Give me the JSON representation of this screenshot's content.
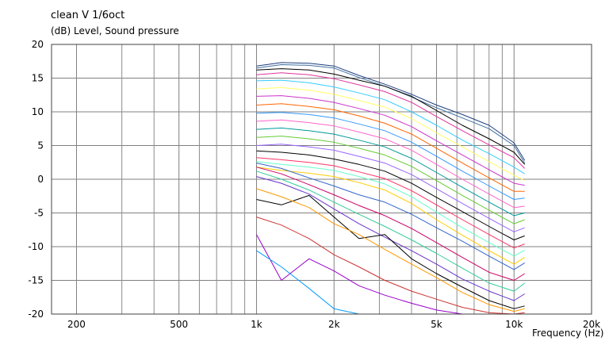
{
  "chart_data": {
    "type": "line",
    "title": "clean V 1/6oct",
    "ylabel": "(dB)  Level, Sound pressure",
    "xlabel": "Frequency  (Hz)",
    "x_scale": "log",
    "xlim": [
      160,
      20000
    ],
    "ylim": [
      -20,
      20
    ],
    "grid": true,
    "x_ticks": [
      {
        "value": 200,
        "label": "200"
      },
      {
        "value": 500,
        "label": "500"
      },
      {
        "value": 1000,
        "label": "1k"
      },
      {
        "value": 2000,
        "label": "2k"
      },
      {
        "value": 5000,
        "label": "5k"
      },
      {
        "value": 10000,
        "label": "10k"
      },
      {
        "value": 20000,
        "label": "20k"
      }
    ],
    "x_minor_ticks": [
      300,
      400,
      600,
      700,
      800,
      900,
      3000,
      4000,
      6000,
      7000,
      8000,
      9000
    ],
    "y_ticks": [
      -20,
      -15,
      -10,
      -5,
      0,
      5,
      10,
      15,
      20
    ],
    "x": [
      1000,
      1250,
      1600,
      2000,
      2500,
      3150,
      4000,
      5000,
      6300,
      8000,
      10000,
      11000
    ],
    "series": [
      {
        "color": "#1f3f7f",
        "values": [
          16.8,
          17.3,
          17.2,
          16.8,
          15.4,
          14.1,
          12.6,
          11.0,
          9.6,
          8.0,
          5.4,
          2.8
        ]
      },
      {
        "color": "#3f6f9f",
        "values": [
          16.5,
          17.0,
          16.9,
          16.5,
          15.1,
          13.8,
          12.2,
          10.6,
          9.1,
          7.5,
          5.0,
          2.4
        ]
      },
      {
        "color": "#000000",
        "values": [
          16.2,
          16.4,
          16.2,
          15.6,
          14.7,
          13.8,
          12.3,
          10.2,
          8.0,
          6.0,
          4.0,
          2.2
        ]
      },
      {
        "color": "#e0339f",
        "values": [
          15.5,
          15.8,
          15.5,
          14.9,
          14.0,
          13.0,
          11.4,
          9.3,
          7.2,
          5.1,
          3.2,
          1.6
        ]
      },
      {
        "color": "#33ccff",
        "values": [
          14.6,
          14.7,
          14.3,
          13.7,
          12.8,
          11.8,
          10.0,
          8.0,
          5.8,
          3.8,
          1.8,
          0.8
        ]
      },
      {
        "color": "#ffff66",
        "values": [
          13.4,
          13.6,
          13.2,
          12.6,
          11.7,
          10.7,
          9.0,
          6.9,
          4.8,
          2.6,
          0.6,
          -0.2
        ]
      },
      {
        "color": "#cc33cc",
        "values": [
          12.3,
          12.4,
          12.0,
          11.4,
          10.5,
          9.5,
          7.8,
          5.7,
          3.6,
          1.4,
          -0.6,
          -0.9
        ]
      },
      {
        "color": "#ff6600",
        "values": [
          11.0,
          11.2,
          10.8,
          10.3,
          9.4,
          8.3,
          6.7,
          4.6,
          2.4,
          0.2,
          -1.8,
          -1.8
        ]
      },
      {
        "color": "#3399ff",
        "values": [
          9.8,
          9.9,
          9.6,
          9.1,
          8.2,
          7.2,
          5.5,
          3.4,
          1.2,
          -1.0,
          -3.0,
          -2.8
        ]
      },
      {
        "color": "#ff66cc",
        "values": [
          8.6,
          8.8,
          8.4,
          7.9,
          7.0,
          6.0,
          4.3,
          2.2,
          0.0,
          -2.2,
          -4.2,
          -4.0
        ]
      },
      {
        "color": "#009999",
        "values": [
          7.4,
          7.6,
          7.2,
          6.7,
          5.8,
          4.8,
          3.1,
          1.0,
          -1.2,
          -3.4,
          -5.4,
          -5.0
        ]
      },
      {
        "color": "#66cc33",
        "values": [
          6.2,
          6.4,
          6.0,
          5.5,
          4.6,
          3.6,
          1.9,
          -0.2,
          -2.4,
          -4.6,
          -6.6,
          -6.0
        ]
      },
      {
        "color": "#9966ff",
        "values": [
          5.0,
          5.2,
          4.8,
          4.3,
          3.4,
          2.4,
          0.7,
          -1.4,
          -3.6,
          -5.8,
          -7.8,
          -7.2
        ]
      },
      {
        "color": "#000000",
        "values": [
          4.2,
          4.0,
          3.6,
          3.0,
          2.2,
          1.2,
          -0.6,
          -2.7,
          -4.8,
          -7.0,
          -9.0,
          -8.4
        ]
      },
      {
        "color": "#ff3366",
        "values": [
          3.2,
          2.9,
          2.5,
          2.0,
          1.1,
          0.1,
          -1.7,
          -3.8,
          -6.0,
          -8.2,
          -10.2,
          -9.6
        ]
      },
      {
        "color": "#66ffcc",
        "values": [
          2.6,
          2.2,
          1.8,
          1.3,
          0.4,
          -0.7,
          -2.6,
          -4.9,
          -7.2,
          -9.4,
          -11.4,
          -10.5
        ]
      },
      {
        "color": "#ffcc00",
        "values": [
          1.8,
          1.3,
          0.9,
          0.4,
          -0.5,
          -1.6,
          -3.6,
          -6.0,
          -8.3,
          -10.6,
          -12.6,
          -11.6
        ]
      },
      {
        "color": "#3366cc",
        "values": [
          2.4,
          1.6,
          0.2,
          -1.0,
          -2.3,
          -3.4,
          -5.2,
          -7.2,
          -9.2,
          -11.4,
          -13.4,
          -12.4
        ]
      },
      {
        "color": "#cc0066",
        "values": [
          1.8,
          0.8,
          -0.8,
          -2.3,
          -3.9,
          -5.4,
          -7.3,
          -9.4,
          -11.6,
          -13.8,
          -15.0,
          -14.0
        ]
      },
      {
        "color": "#33cc99",
        "values": [
          1.2,
          0.0,
          -1.6,
          -3.4,
          -5.2,
          -7.0,
          -9.0,
          -11.0,
          -13.2,
          -15.4,
          -16.6,
          -15.4
        ]
      },
      {
        "color": "#6633cc",
        "values": [
          0.4,
          -0.6,
          -2.2,
          -4.4,
          -6.6,
          -8.6,
          -10.6,
          -12.6,
          -14.8,
          -16.6,
          -18.0,
          -17.0
        ]
      },
      {
        "color": "#000000",
        "values": [
          -3.0,
          -3.8,
          -2.4,
          -5.6,
          -8.8,
          -8.2,
          -11.8,
          -14.0,
          -16.0,
          -18.0,
          -19.2,
          -18.8
        ]
      },
      {
        "color": "#ff9900",
        "values": [
          -1.4,
          -2.6,
          -4.2,
          -6.6,
          -8.2,
          -10.4,
          -12.6,
          -14.6,
          -16.8,
          -18.6,
          -19.6,
          -19.2
        ]
      },
      {
        "color": "#cc3333",
        "values": [
          -5.6,
          -6.8,
          -8.8,
          -11.2,
          -13.0,
          -15.0,
          -16.6,
          -17.8,
          -19.0,
          -19.8,
          -20.0,
          -19.8
        ]
      },
      {
        "color": "#9900cc",
        "values": [
          -8.2,
          -15.0,
          -11.8,
          -13.6,
          -15.8,
          -17.2,
          -18.4,
          -19.4,
          -20.0,
          -20.0,
          -20.0,
          -20.0
        ]
      },
      {
        "color": "#0099ff",
        "values": [
          -10.6,
          -13.0,
          -16.2,
          -19.2,
          -20.0,
          -20.0,
          -20.0,
          -20.0,
          -20.0,
          -20.0,
          -20.0,
          -20.0
        ]
      }
    ]
  }
}
